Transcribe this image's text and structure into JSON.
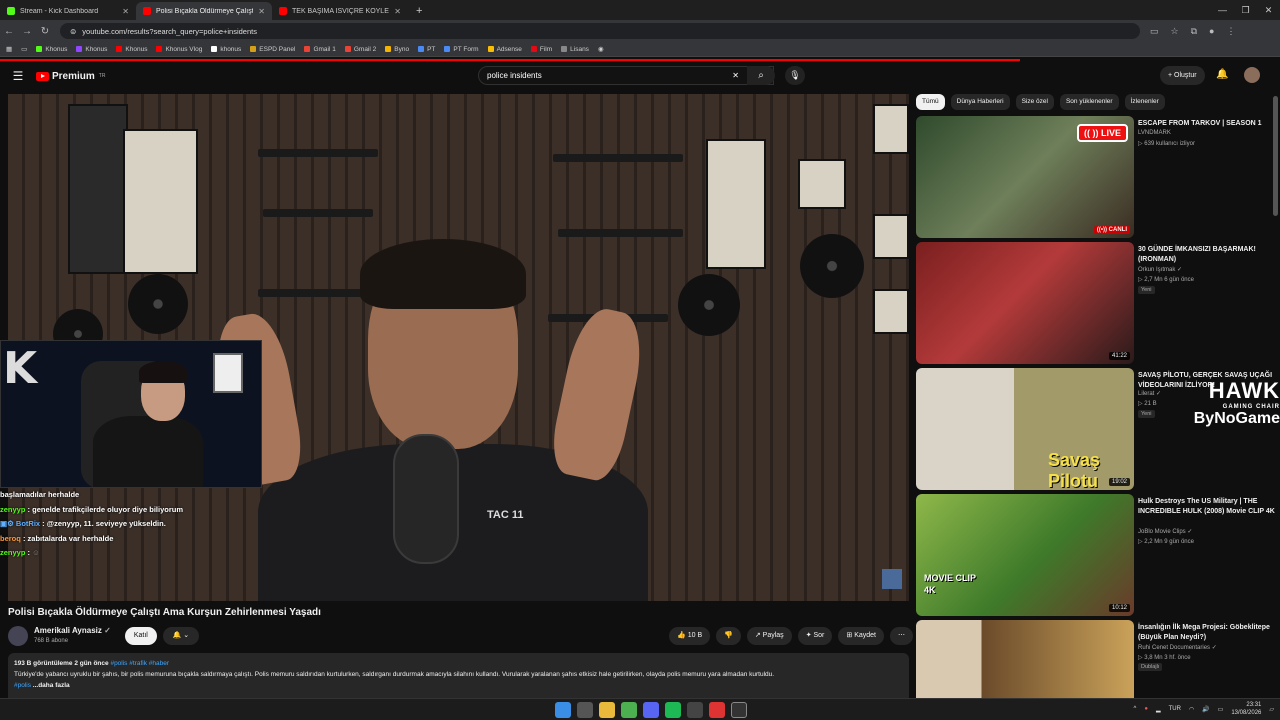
{
  "browser": {
    "tabs": [
      {
        "title": "Stream - Kick Dashboard",
        "color": "#53fc18"
      },
      {
        "title": "Polisi Bıçakla Öldürmeye Çalıştı",
        "color": "#ff0000"
      },
      {
        "title": "TEK BAŞIMA İSVİÇRE KÖYLERİN",
        "color": "#ff0000"
      }
    ],
    "new_tab": "+",
    "url": "youtube.com/results?search_query=police+insidents",
    "bookmarks": [
      "Khonus",
      "Khonus",
      "Khonus",
      "Khonus Vlog",
      "khonus",
      "ESPD Panel",
      "Gmail 1",
      "Gmail 2",
      "Byno",
      "PT",
      "PT Form",
      "Adsense",
      "Film",
      "Lisans"
    ]
  },
  "youtube": {
    "logo": "Premium",
    "logo_sup": "TR",
    "search_value": "police insidents",
    "create_label": "+ Oluştur"
  },
  "chat": [
    {
      "user": "",
      "text": "başlamadılar herhalde",
      "user_color": "#53fc18"
    },
    {
      "user": "zenyyp",
      "text": ": genelde trafikçilerde oluyor diye biliyorum",
      "user_color": "#53fc18"
    },
    {
      "user": "BotRix",
      "text": ": @zenyyp, 11. seviyeye yükseldin.",
      "user_color": "#5fb0ff"
    },
    {
      "user": "beroq",
      "text": ": zabıtalarda var herhalde",
      "user_color": "#ff9a3c"
    },
    {
      "user": "zenyyp",
      "text": ":",
      "user_color": "#53fc18"
    }
  ],
  "webcam": {
    "logo_letter": "K"
  },
  "video": {
    "title": "Polisi Bıçakla Öldürmeye Çalıştı Ama Kurşun Zehirlenmesi Yaşadı",
    "shirt_text": "TAC 11",
    "channel": "Amerikali Aynasiz",
    "subscribers": "768 B abone",
    "join_label": "Katıl",
    "bell_label": "🔔 ⌄",
    "actions": [
      "👍 10 B",
      "👎",
      "↗ Paylaş",
      "✦ Sor",
      "⊞ Kaydet",
      "⋯"
    ],
    "views_date": "193 B görüntüleme  2 gün önce",
    "tags": "#polis #trafik #haber",
    "description": "Türkiye'de yabancı uyruklu bir şahıs, bir polis memuruna bıçakla saldırmaya çalıştı. Polis memuru saldırıdan kurtulurken, saldırganı durdurmak amacıyla silahını kullandı. Vurularak yaralanan şahıs etkisiz hale getirilirken, olayda polis memuru yara almadan kurtuldu.",
    "more_prefix": "#polis",
    "more_label": "...daha fazla"
  },
  "chips": [
    "Tümü",
    "Dünya Haberleri",
    "Size özel",
    "Son yüklenenler",
    "İzlenenler"
  ],
  "sidebar": [
    {
      "title": "ESCAPE FROM TARKOV | SEASON 1",
      "channel": "LVNDMARK",
      "meta": "▷ 639 kullanıcı izliyor",
      "duration": "",
      "live": "((•)) CANLI",
      "live_tag": "(( )) LIVE",
      "badge": "",
      "color": "#3c5a3a"
    },
    {
      "title": "30 GÜNDE İMKANSIZI BAŞARMAK! (IRONMAN)",
      "channel": "Orkun Işıtmak ✓",
      "meta": "▷ 2,7 Mn  6 gün önce",
      "duration": "41:22",
      "live": "",
      "live_tag": "",
      "badge": "Yeni",
      "color": "#8a2b2b"
    },
    {
      "title": "SAVAŞ PİLOTU, GERÇEK SAVAŞ UÇAĞI VİDEOLARINI İZLİYOR!",
      "channel": "Lilerat ✓",
      "meta": "▷ 21 B",
      "duration": "19:02",
      "live": "",
      "live_tag": "",
      "badge": "Yeni",
      "color": "#b7a66a",
      "overlay": "Savaş Pilotu"
    },
    {
      "title": "Hulk Destroys The US Military | THE INCREDIBLE HULK (2008) Movie CLIP 4K",
      "channel": "JoBlo Movie Clips ✓",
      "meta": "▷ 2,2 Mn  9 gün önce",
      "duration": "10:12",
      "live": "",
      "live_tag": "",
      "badge": "",
      "color": "#3e7a2a",
      "overlay": "MOVIE CLIP 4K"
    },
    {
      "title": "İnsanlığın İlk Mega Projesi: Göbeklitepe (Büyük Plan Neydi?)",
      "channel": "Ruhi Cenet Documentaries ✓",
      "meta": "▷ 3,8 Mn  3 hf. önce",
      "duration": "",
      "live": "",
      "live_tag": "",
      "badge": "Dublajlı",
      "color": "#6a4a2a"
    }
  ],
  "overlay_brand": {
    "line1": "HAWK",
    "line2": "GAMING CHAIR",
    "line3": "ByNoGame"
  },
  "tray": {
    "lang": "TUR",
    "time": "23:31",
    "date": "13/08/2026"
  }
}
